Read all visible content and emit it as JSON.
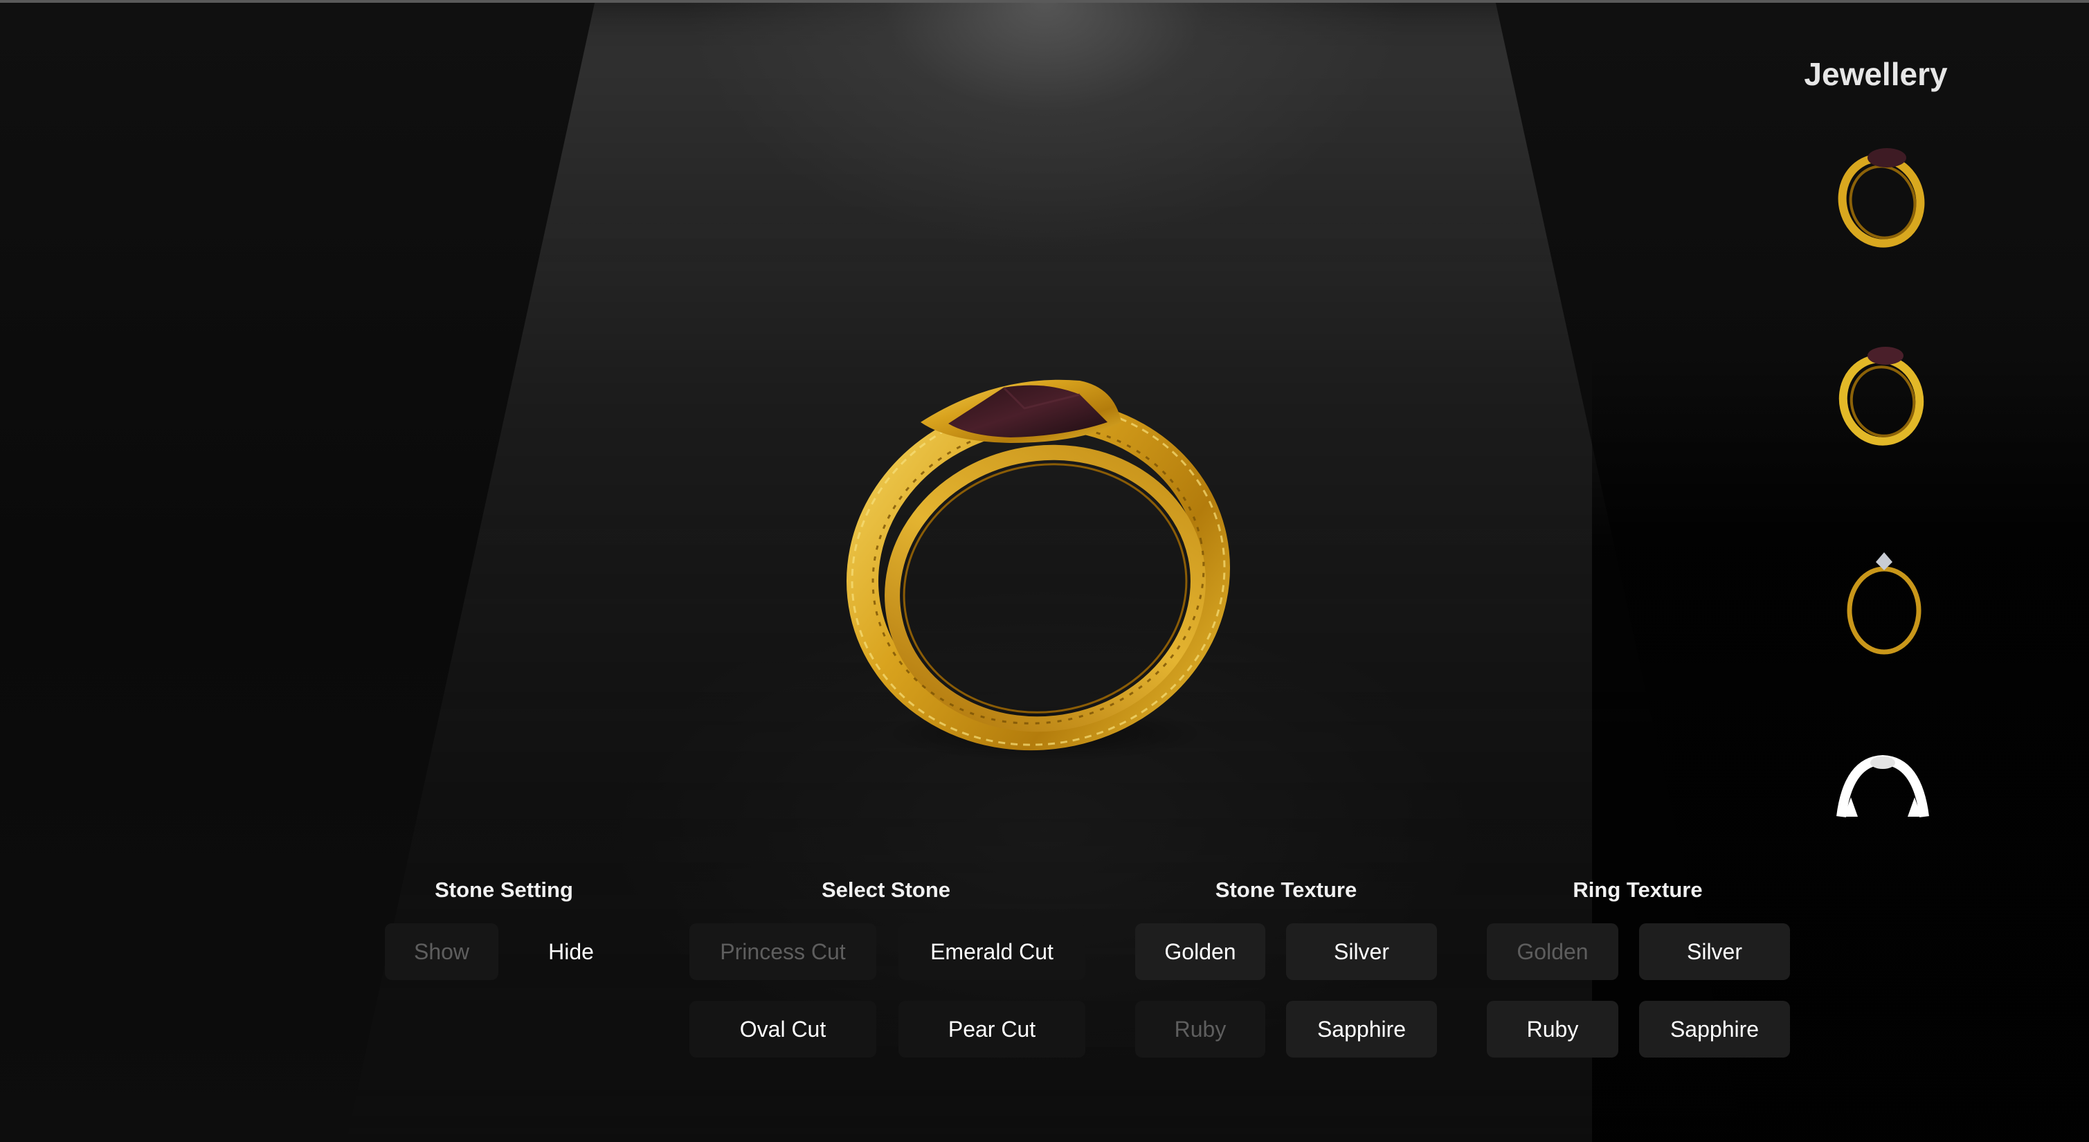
{
  "sidebar": {
    "title": "Jewellery",
    "thumbnails": [
      {
        "icon": "gold-ring-red-stone-icon"
      },
      {
        "icon": "gold-ring-red-stone-icon"
      },
      {
        "icon": "gold-ring-diamond-icon"
      },
      {
        "icon": "silver-ring-icon"
      }
    ]
  },
  "controls": {
    "stone_setting": {
      "title": "Stone Setting",
      "options": [
        {
          "label": "Show",
          "state": "disabled"
        },
        {
          "label": "Hide",
          "state": "active"
        }
      ]
    },
    "select_stone": {
      "title": "Select Stone",
      "options": [
        {
          "label": "Princess Cut",
          "state": "disabled"
        },
        {
          "label": "Emerald Cut",
          "state": "active"
        },
        {
          "label": "Oval Cut",
          "state": "active"
        },
        {
          "label": "Pear Cut",
          "state": "active"
        }
      ]
    },
    "stone_texture": {
      "title": "Stone Texture",
      "options": [
        {
          "label": "Golden",
          "state": "active"
        },
        {
          "label": "Silver",
          "state": "active"
        },
        {
          "label": "Ruby",
          "state": "disabled"
        },
        {
          "label": "Sapphire",
          "state": "active"
        }
      ]
    },
    "ring_texture": {
      "title": "Ring Texture",
      "options": [
        {
          "label": "Golden",
          "state": "disabled"
        },
        {
          "label": "Silver",
          "state": "active"
        },
        {
          "label": "Ruby",
          "state": "active"
        },
        {
          "label": "Sapphire",
          "state": "active"
        }
      ]
    }
  },
  "colors": {
    "gold": "#d4a21f",
    "stone": "#3a1a22",
    "button_bg": "#1e1e1e",
    "disabled_text": "#5e5e5e"
  }
}
